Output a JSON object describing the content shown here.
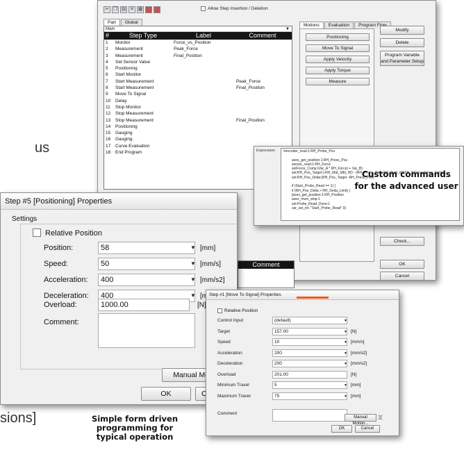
{
  "side_text": {
    "top": "us",
    "bottom": "sions]"
  },
  "main_window": {
    "toolbar_icons": [
      "cut-icon",
      "copy-icon",
      "paste-icon",
      "delete-icon",
      "grid-icon",
      "flag-icon",
      "flag-icon"
    ],
    "allow_label": "Allow Step Insertion / Deletion",
    "left_tabs": [
      "Part",
      "Global"
    ],
    "grid_title": "Main",
    "grid_arrow": "▼",
    "columns": {
      "num": "#",
      "type": "Step Type",
      "label": "Label",
      "comment": "Comment"
    },
    "rows": [
      {
        "num": "1",
        "type": "Monitor",
        "label": "Force_vs_Position",
        "comment": ""
      },
      {
        "num": "2",
        "type": "Measurement",
        "label": "Peak_Force",
        "comment": ""
      },
      {
        "num": "3",
        "type": "Measurement",
        "label": "Final_Position",
        "comment": ""
      },
      {
        "num": "4",
        "type": "Set Sensor Value",
        "label": "",
        "comment": ""
      },
      {
        "num": "5",
        "type": "Positioning",
        "label": "",
        "comment": ""
      },
      {
        "num": "6",
        "type": "Start Monitor",
        "label": "",
        "comment": ""
      },
      {
        "num": "7",
        "type": "Start Measurement",
        "label": "",
        "comment": "Peak_Force"
      },
      {
        "num": "8",
        "type": "Start Measurement",
        "label": "",
        "comment": "Final_Position"
      },
      {
        "num": "9",
        "type": "Move To Signal",
        "label": "",
        "comment": ""
      },
      {
        "num": "10",
        "type": "Delay",
        "label": "",
        "comment": ""
      },
      {
        "num": "11",
        "type": "Stop Monitor",
        "label": "",
        "comment": ""
      },
      {
        "num": "12",
        "type": "Stop Measurement",
        "label": "",
        "comment": ""
      },
      {
        "num": "13",
        "type": "Stop Measurement",
        "label": "",
        "comment": "Final_Position"
      },
      {
        "num": "14",
        "type": "Positioning",
        "label": "",
        "comment": ""
      },
      {
        "num": "15",
        "type": "Gauging",
        "label": "",
        "comment": ""
      },
      {
        "num": "16",
        "type": "Gauging",
        "label": "",
        "comment": ""
      },
      {
        "num": "17",
        "type": "Curve Evaluation",
        "label": "",
        "comment": ""
      },
      {
        "num": "18",
        "type": "End Program",
        "label": "",
        "comment": ""
      }
    ],
    "right_tabs": [
      "Motions",
      "Evaluation",
      "Program Flow"
    ],
    "command_buttons": [
      "Positioning",
      "Move To Signal",
      "Apply Velocity",
      "Apply Torque",
      "Measure"
    ],
    "side_buttons": {
      "modify": "Modify",
      "delete": "Delete",
      "program_var": "Program Variable and Parameter Setup",
      "check": "Check...",
      "ok": "OK",
      "cancel": "Cancel"
    },
    "lower_comment_header": "Comment"
  },
  "expression_window": {
    "label": "Expression",
    "lines": [
      "#encoder_read:1:RH_Probe_Pos",
      "",
      "axes_get_position:1:RH_Press_Pos",
      "sensor_read:1:RH_Force",
      "setForce_Comp:(Var_A * RH_Force) + Var_B)",
      "set:RH_Pos_Target:(-RH_Mat_Sfld_HD - (RH_Probe_Pos -RH_Prob_MSTR_STI )) + Force_Comp)",
      "set:RH_Pos_Delta:(RH_Pos_Target -RH_Press_Pos)",
      "",
      "if (Start_Probe_Read == 1) {",
      "if (RH_Pos_Delta > RH_Delta_Limit) {",
      "[axes_get_position:1:RH_Position",
      "axes_mvm_stop:1",
      "set:Probe_Read_Done:1",
      "var_set_int: \"Start_Probe_Read\" 0}"
    ],
    "callout": [
      "Custom commands",
      "for the advanced user"
    ]
  },
  "positioning_dialog": {
    "title": "Step #5 [Positioning] Properties",
    "settings_label": "Settings",
    "relative_position": "Relative Position",
    "fields": [
      {
        "label": "Position:",
        "value": "58",
        "unit": "[mm]",
        "dropdown": true
      },
      {
        "label": "Speed:",
        "value": "50",
        "unit": "[mm/s]",
        "dropdown": true
      },
      {
        "label": "Acceleration:",
        "value": "400",
        "unit": "[mm/s2]",
        "dropdown": true
      },
      {
        "label": "Deceleration:",
        "value": "400",
        "unit": "[mm/s2]",
        "dropdown": true
      },
      {
        "label": "Overload:",
        "value": "1000.00",
        "unit": "[N]",
        "dropdown": false
      }
    ],
    "comment_label": "Comment:",
    "manual_motion": "Manual Motion...",
    "ok": "OK",
    "cancel": "Cancel"
  },
  "signal_dialog": {
    "title": "Step #1 [Move To Signal] Properties",
    "relative_position": "Relative Position",
    "fields": [
      {
        "label": "Control Input",
        "value": "(default)",
        "unit": ""
      },
      {
        "label": "Target",
        "value": "157.00",
        "unit": "[N]"
      },
      {
        "label": "Speed",
        "value": "10",
        "unit": "[mm/s]"
      },
      {
        "label": "Acceleration",
        "value": "200",
        "unit": "[mm/s2]"
      },
      {
        "label": "Deceleration",
        "value": "200",
        "unit": "[mm/s2]"
      },
      {
        "label": "Overload",
        "value": "201.00",
        "unit": "[N]"
      },
      {
        "label": "Minimum Travel",
        "value": "5",
        "unit": "[mm]"
      },
      {
        "label": "Maximum Travel",
        "value": "75",
        "unit": "[mm]"
      }
    ],
    "comment_label": "Comment",
    "manual_motion": "Manual Motion...",
    "ok": "OK",
    "cancel": "Cancel"
  },
  "caption": [
    "Simple form driven",
    "programming for",
    "typical operation"
  ]
}
